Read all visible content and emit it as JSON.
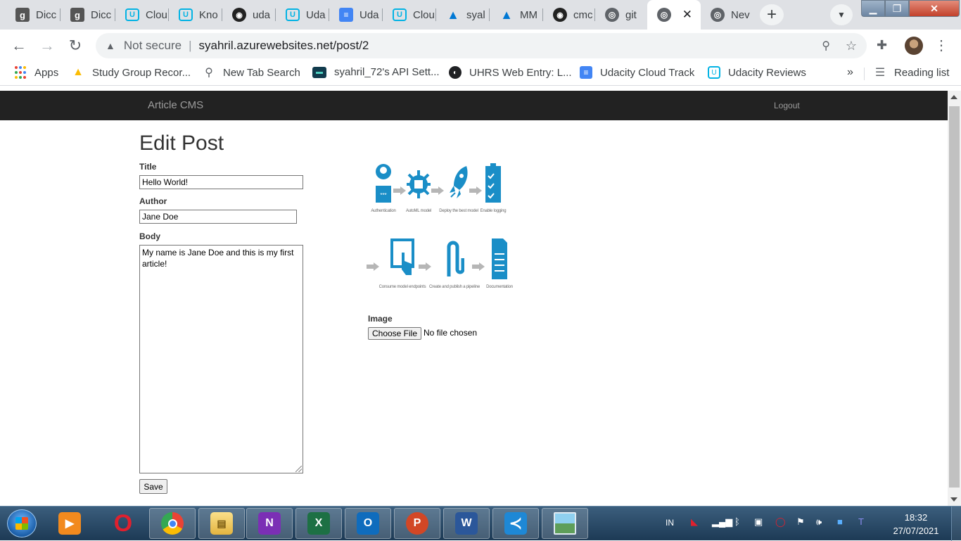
{
  "browser": {
    "tabs": [
      {
        "title": "Dicc",
        "icon": "goodreads-icon"
      },
      {
        "title": "Dicc",
        "icon": "goodreads-icon"
      },
      {
        "title": "Clou",
        "icon": "udacity-icon"
      },
      {
        "title": "Kno",
        "icon": "udacity-icon"
      },
      {
        "title": "uda",
        "icon": "github-icon"
      },
      {
        "title": "Uda",
        "icon": "udacity-icon"
      },
      {
        "title": "Uda",
        "icon": "docs-icon"
      },
      {
        "title": "Clou",
        "icon": "udacity-icon"
      },
      {
        "title": "syal",
        "icon": "azure-icon"
      },
      {
        "title": "MM",
        "icon": "azure-icon"
      },
      {
        "title": "cmc",
        "icon": "github-icon"
      },
      {
        "title": "git",
        "icon": "globe-icon"
      },
      {
        "title": "",
        "icon": "globe-icon",
        "active": true
      },
      {
        "title": "Nev",
        "icon": "globe-icon"
      }
    ],
    "security_label": "Not secure",
    "url": "syahril.azurewebsites.net/post/2",
    "bookmarks": [
      {
        "label": "Apps",
        "icon": "apps-icon"
      },
      {
        "label": "Study Group Recor...",
        "icon": "drive-icon"
      },
      {
        "label": "New Tab Search",
        "icon": "search-icon"
      },
      {
        "label": "syahril_72's API Sett...",
        "icon": "api-icon"
      },
      {
        "label": "UHRS Web Entry: L...",
        "icon": "uhrs-icon"
      },
      {
        "label": "Udacity Cloud Track",
        "icon": "docs-icon"
      },
      {
        "label": "Udacity Reviews",
        "icon": "udacity-icon"
      }
    ],
    "more_bookmarks": "»",
    "reading_list": "Reading list"
  },
  "app": {
    "brand": "Article CMS",
    "logout": "Logout",
    "heading": "Edit Post",
    "form": {
      "title_label": "Title",
      "title_value": "Hello World!",
      "author_label": "Author",
      "author_value": "Jane Doe",
      "body_label": "Body",
      "body_value": "My name is Jane Doe and this is my first article!",
      "image_label": "Image",
      "choose_file": "Choose File",
      "no_file": "No file chosen",
      "save": "Save"
    },
    "diagram": {
      "row1": [
        "Authentication",
        "AutoML model",
        "Deploy the best model",
        "Enable logging"
      ],
      "row2": [
        "Consume model endpoints",
        "Create and publish a pipeline",
        "Documentation"
      ],
      "color": "#1a8ec7"
    }
  },
  "taskbar": {
    "lang": "IN",
    "time": "18:32",
    "date": "27/07/2021"
  }
}
